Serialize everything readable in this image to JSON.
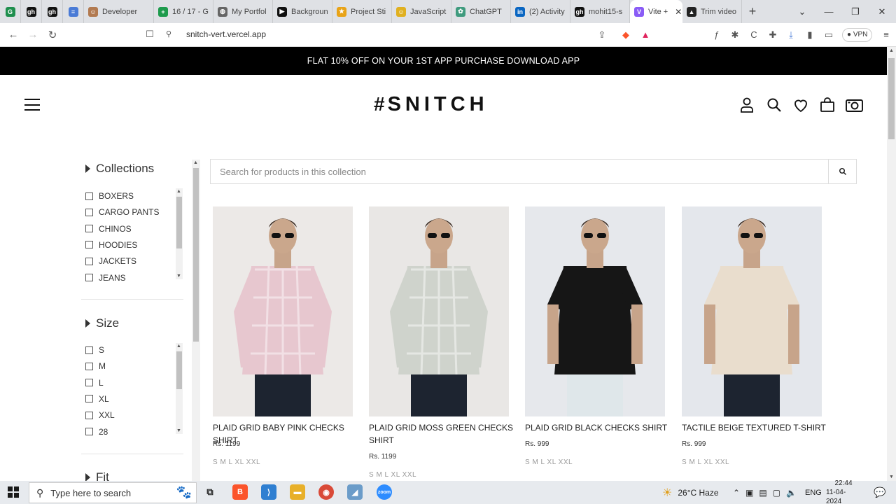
{
  "browser": {
    "tabs": [
      {
        "label": "",
        "fav": "G",
        "color": "#1f8f4e"
      },
      {
        "label": "",
        "fav": "gh",
        "color": "#111"
      },
      {
        "label": "",
        "fav": "gh",
        "color": "#111"
      },
      {
        "label": "",
        "fav": "≡",
        "color": "#4a7bd6"
      },
      {
        "label": "Developer",
        "fav": "☺",
        "color": "#b27a50"
      },
      {
        "label": "16 / 17 - G",
        "fav": "+",
        "color": "#1e9b4d"
      },
      {
        "label": "My Portfol",
        "fav": "◍",
        "color": "#666"
      },
      {
        "label": "Backgroun",
        "fav": "▶",
        "color": "#111"
      },
      {
        "label": "Project Sti",
        "fav": "★",
        "color": "#e8a317"
      },
      {
        "label": "JavaScript",
        "fav": "☺",
        "color": "#e0b020"
      },
      {
        "label": "ChatGPT",
        "fav": "✿",
        "color": "#3f9b7e"
      },
      {
        "label": "(2) Activity",
        "fav": "in",
        "color": "#0a66c2"
      },
      {
        "label": "mohit15-s",
        "fav": "gh",
        "color": "#111"
      },
      {
        "label": "Vite +",
        "fav": "V",
        "color": "#8a5cf6",
        "active": true
      },
      {
        "label": "Trim video",
        "fav": "▲",
        "color": "#222"
      }
    ],
    "url": "snitch-vert.vercel.app",
    "vpn_label": "VPN"
  },
  "page": {
    "promo": "FLAT 10% OFF ON YOUR 1ST APP PURCHASE DOWNLOAD APP",
    "brand": "SNITCH",
    "brand_mark": "#",
    "search_placeholder": "Search for products in this collection",
    "filters": {
      "collections": {
        "title": "Collections",
        "items": [
          "BOXERS",
          "CARGO PANTS",
          "CHINOS",
          "HOODIES",
          "JACKETS",
          "JEANS"
        ]
      },
      "size": {
        "title": "Size",
        "items": [
          "S",
          "M",
          "L",
          "XL",
          "XXL",
          "28"
        ]
      },
      "fit": {
        "title": "Fit"
      }
    },
    "products": [
      {
        "name": "PLAID GRID BABY PINK CHECKS SHIRT",
        "price": "Rs. 1199",
        "sizes": "S M L XL XXL",
        "shirt": "#e7c7cf",
        "bg": "#ece9e7"
      },
      {
        "name": "PLAID GRID MOSS GREEN CHECKS SHIRT",
        "price": "Rs. 1199",
        "sizes": "S M L XL XXL",
        "shirt": "#cfd3cc",
        "bg": "#e9e7e5"
      },
      {
        "name": "PLAID GRID BLACK CHECKS SHIRT",
        "price": "Rs. 999",
        "sizes": "S M L XL XXL",
        "shirt": "#161616",
        "bg": "#e6e8ec"
      },
      {
        "name": "TACTILE BEIGE TEXTURED T-SHIRT",
        "price": "Rs. 999",
        "sizes": "S M L XL XXL",
        "shirt": "#e9ddcd",
        "bg": "#e4e7ec"
      }
    ]
  },
  "taskbar": {
    "search_placeholder": "Type here to search",
    "weather": "26°C  Haze",
    "language": "ENG",
    "time": "22:44",
    "date": "11-04-2024"
  }
}
